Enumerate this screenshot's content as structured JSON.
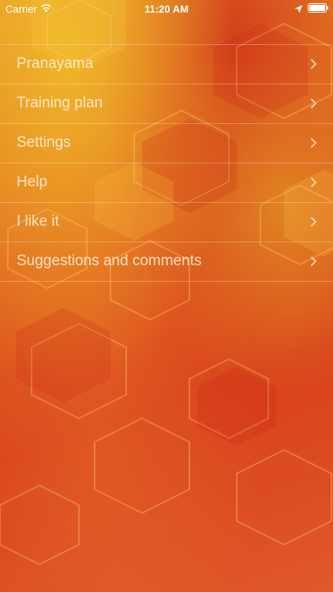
{
  "status_bar": {
    "carrier": "Carrier",
    "time": "11:20 AM",
    "icons": [
      "wifi-icon",
      "location-arrow-icon",
      "battery-icon"
    ],
    "battery_level_pct": 100
  },
  "menu": {
    "items": [
      {
        "label": "Pranayama"
      },
      {
        "label": "Training plan"
      },
      {
        "label": "Settings"
      },
      {
        "label": "Help"
      },
      {
        "label": "I like it"
      },
      {
        "label": "Suggestions and comments"
      }
    ],
    "chevron_icon": "chevron-right-icon"
  },
  "colors": {
    "background_primary": "#d9401a",
    "background_accent": "#e8962a",
    "text": "#ffebd7",
    "separator": "rgba(255,255,255,0.28)"
  }
}
